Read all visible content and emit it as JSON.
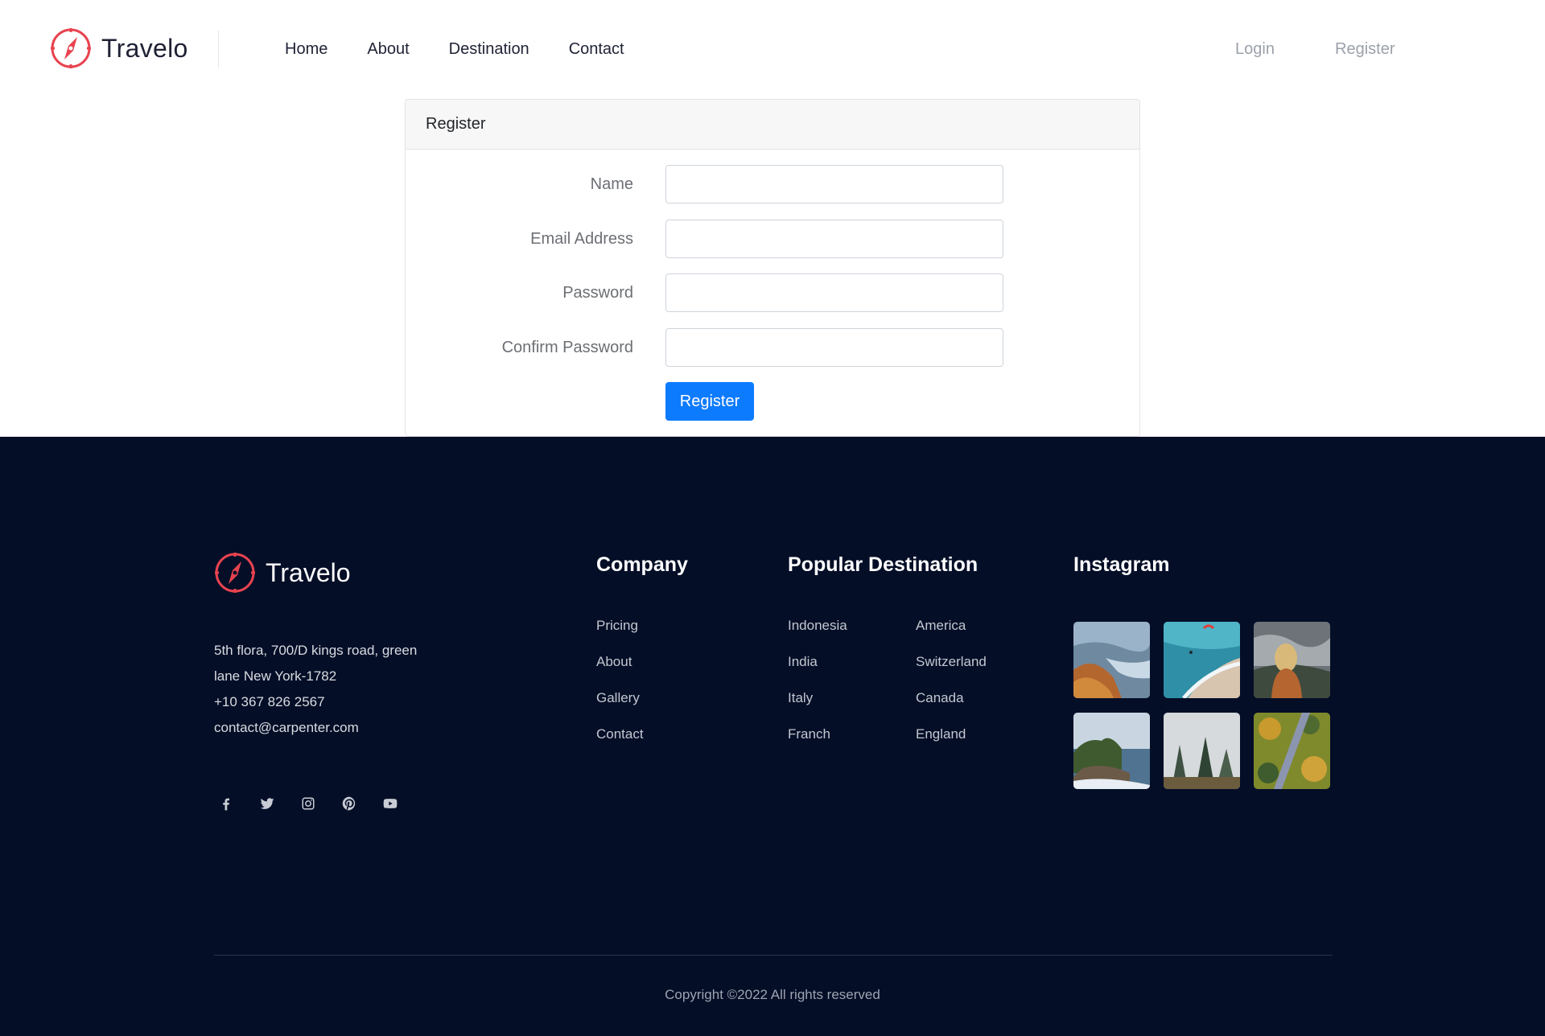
{
  "header": {
    "brand": "Travelo",
    "nav": [
      {
        "label": "Home"
      },
      {
        "label": "About"
      },
      {
        "label": "Destination"
      },
      {
        "label": "Contact"
      }
    ],
    "login_label": "Login",
    "register_label": "Register"
  },
  "register_card": {
    "title": "Register",
    "fields": [
      {
        "label": "Name",
        "value": ""
      },
      {
        "label": "Email Address",
        "value": ""
      },
      {
        "label": "Password",
        "value": ""
      },
      {
        "label": "Confirm Password",
        "value": ""
      }
    ],
    "submit_label": "Register",
    "accent_color": "#0d7bfd"
  },
  "footer": {
    "brand": "Travelo",
    "address_lines": [
      "5th flora, 700/D kings road, green",
      "lane New York-1782",
      "+10 367 826 2567",
      "contact@carpenter.com"
    ],
    "social_icons": [
      "facebook-icon",
      "twitter-icon",
      "instagram-icon",
      "pinterest-icon",
      "youtube-icon"
    ],
    "company": {
      "title": "Company",
      "links": [
        "Pricing",
        "About",
        "Gallery",
        "Contact"
      ]
    },
    "popular_destination": {
      "title": "Popular Destination",
      "column_1": [
        "Indonesia",
        "India",
        "Italy",
        "Franch"
      ],
      "column_2": [
        "America",
        "Switzerland",
        "Canada",
        "England"
      ]
    },
    "instagram": {
      "title": "Instagram",
      "photos": [
        "mountain-river-photo",
        "beach-paraglider-photo",
        "hiker-fog-photo",
        "sea-temple-photo",
        "misty-forest-photo",
        "autumn-forest-road-photo"
      ]
    },
    "copyright": "Copyright ©2022 All rights reserved",
    "background_color": "#040e27"
  }
}
